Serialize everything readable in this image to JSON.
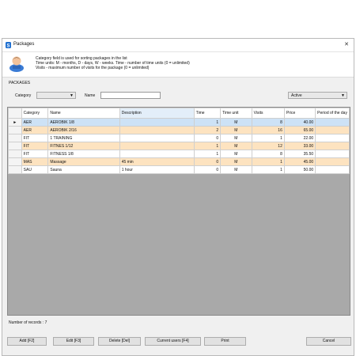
{
  "window": {
    "title": "Packages",
    "close_glyph": "✕"
  },
  "info": {
    "lines": [
      "Category field is used for sorting packages in the list",
      "Time units: M - months, D - days, W - weeks. Time - number of time units (0 = unlimited)",
      "Visits - maximum number of visits for the package (0 = unlimited)"
    ]
  },
  "filters": {
    "section_label": "PACKAGES",
    "category_label": "Category",
    "category_value": "",
    "name_label": "Name",
    "name_value": "",
    "status_value": "Active"
  },
  "table": {
    "columns": [
      "Category",
      "Name",
      "Description",
      "Time",
      "Time unit",
      "Visits",
      "Price",
      "Period of the day"
    ],
    "current_row_marker": "►",
    "rows": [
      {
        "category": "AER",
        "name": "AEROBIK 1/8",
        "description": "",
        "time": "1",
        "time_unit": "M",
        "visits": "8",
        "price": "40.00",
        "period": ""
      },
      {
        "category": "AER",
        "name": "AEROBIK 2/16",
        "description": "",
        "time": "2",
        "time_unit": "M",
        "visits": "16",
        "price": "65.00",
        "period": ""
      },
      {
        "category": "FIT",
        "name": "1 TRAINING",
        "description": "",
        "time": "0",
        "time_unit": "M",
        "visits": "1",
        "price": "22.00",
        "period": ""
      },
      {
        "category": "FIT",
        "name": "FITNES 1/12",
        "description": "",
        "time": "1",
        "time_unit": "M",
        "visits": "12",
        "price": "33.00",
        "period": ""
      },
      {
        "category": "FIT",
        "name": "FITNESS 1/8",
        "description": "",
        "time": "1",
        "time_unit": "M",
        "visits": "8",
        "price": "35.50",
        "period": ""
      },
      {
        "category": "MAS",
        "name": "Massage",
        "description": "45 min",
        "time": "0",
        "time_unit": "M",
        "visits": "1",
        "price": "45.00",
        "period": ""
      },
      {
        "category": "SAU",
        "name": "Sauna",
        "description": "1 hour",
        "time": "0",
        "time_unit": "M",
        "visits": "1",
        "price": "50.00",
        "period": ""
      }
    ]
  },
  "status_bar": {
    "records_text": "Number of records : 7"
  },
  "buttons": {
    "add": "Add [F2]",
    "edit": "Edit [F3]",
    "delete": "Delete [Del]",
    "current_users": "Current users [F4]",
    "print": "Print",
    "cancel": "Cancel"
  },
  "colors": {
    "selected_row": "#cde2f6",
    "orange_row": "#fde3c0",
    "white_row": "#ffffff",
    "grid_empty_area": "#a9a9a9",
    "accent_icon": "#1e6fd0"
  }
}
